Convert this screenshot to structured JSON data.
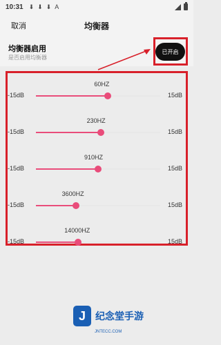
{
  "status_bar": {
    "time": "10:31",
    "indicators": [
      "⬇",
      "⬇",
      "⬇",
      "A"
    ]
  },
  "header": {
    "cancel_label": "取消",
    "title": "均衡器"
  },
  "toggle": {
    "title": "均衡器启用",
    "subtitle": "是否启用均衡器",
    "button_label": "已开启",
    "enabled": true
  },
  "equalizer": {
    "bands": [
      {
        "label": "60HZ",
        "min_label": "-15dB",
        "max_label": "15dB",
        "level": 0.58
      },
      {
        "label": "230HZ",
        "min_label": "-15dB",
        "max_label": "15dB",
        "level": 0.52
      },
      {
        "label": "910HZ",
        "min_label": "-15dB",
        "max_label": "15dB",
        "level": 0.5
      },
      {
        "label": "3600HZ",
        "min_label": "-15dB",
        "max_label": "15dB",
        "level": 0.32
      },
      {
        "label": "14000HZ",
        "min_label": "-15dB",
        "max_label": "15dB",
        "level": 0.34
      }
    ]
  },
  "watermark": {
    "logo_char": "J",
    "brand": "纪念堂手游",
    "url": "JNTECC.COM"
  },
  "colors": {
    "accent": "#e94c7a",
    "highlight": "#d8202a",
    "brand": "#1a5fb4"
  }
}
